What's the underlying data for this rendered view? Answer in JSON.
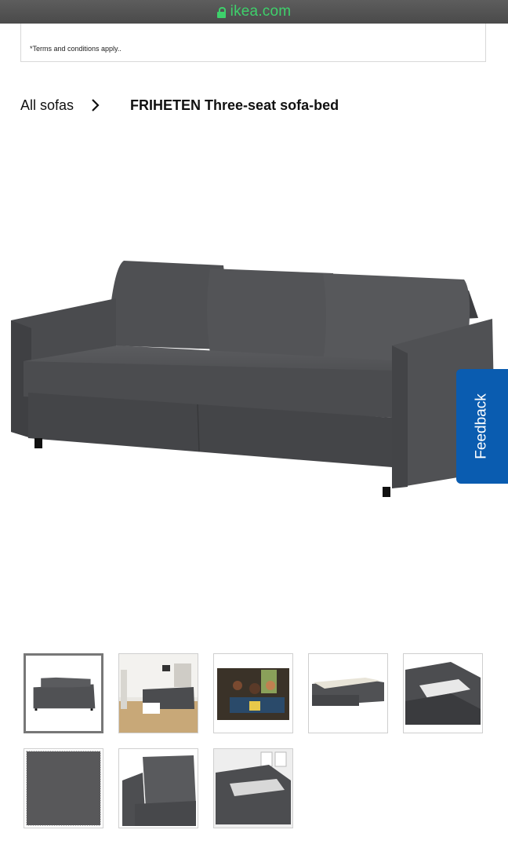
{
  "browser": {
    "url": "ikea.com",
    "lock_icon": "lock-icon"
  },
  "terms": {
    "text": "*Terms and conditions apply.."
  },
  "breadcrumb": {
    "parent": "All sofas",
    "current": "FRIHETEN Three-seat sofa-bed",
    "separator_icon": "chevron-right-icon"
  },
  "product": {
    "main_image": "sofa-bed-main-image"
  },
  "feedback": {
    "label": "Feedback"
  },
  "thumbnails": {
    "selected_index": 0,
    "items": [
      "sofa-front",
      "living-room",
      "family-scene",
      "sofa-bed-open",
      "storage-detail",
      "fabric-swatch",
      "cushion-detail",
      "storage-open"
    ]
  },
  "colors": {
    "feedback_bg": "#0a5cb0",
    "url_green": "#3ed06b"
  }
}
